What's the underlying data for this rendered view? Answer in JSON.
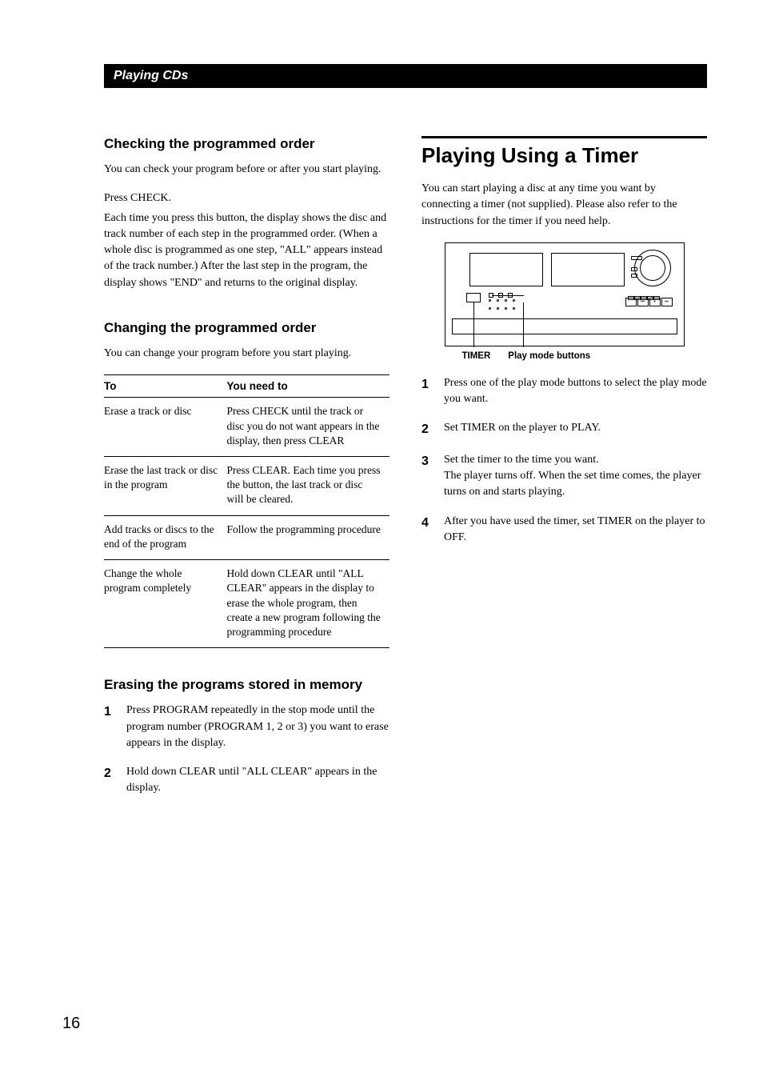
{
  "band": "Playing CDs",
  "left": {
    "h_check": "Checking the programmed order",
    "p_check": "You can check your program before or after you start playing.",
    "p_press": "Press CHECK.",
    "p_press_body": "Each time you press this button, the display shows the disc and track number of each step in the programmed order. (When a whole disc is programmed as one step, \"ALL\" appears instead of the track number.) After the last step in the program, the display shows \"END\" and returns to the original display.",
    "h_change": "Changing the programmed order",
    "p_change": "You can change your program before you start playing.",
    "th_to": "To",
    "th_need": "You need to",
    "rows": [
      {
        "to": "Erase a track or disc",
        "need": "Press CHECK until the track or disc you do not want appears in the display, then press CLEAR"
      },
      {
        "to": "Erase the last track or disc in the program",
        "need": "Press CLEAR. Each time you press the button, the last track or disc will be cleared."
      },
      {
        "to": "Add tracks or discs to the end of the program",
        "need": "Follow the programming procedure"
      },
      {
        "to": "Change the whole program completely",
        "need": "Hold down CLEAR until \"ALL CLEAR\" appears in the display to erase the whole program, then create a new program following the programming procedure"
      }
    ],
    "h_erase": "Erasing the programs stored in memory",
    "erase_steps": [
      "Press PROGRAM repeatedly in the stop mode until the program number (PROGRAM 1, 2 or 3) you want to erase appears in the display.",
      "Hold down CLEAR until \"ALL CLEAR\" appears in the display."
    ]
  },
  "right": {
    "h_main": "Playing Using a Timer",
    "p_intro": "You can start playing a disc at any time you want by connecting a timer (not supplied). Please also refer to the instructions for the timer if you need help.",
    "label_timer": "TIMER",
    "label_play": "Play mode buttons",
    "steps": [
      "Press one of the play mode buttons to select the play mode you want.",
      "Set TIMER on the player to PLAY.",
      "Set the timer to the time you want.\nThe player turns off. When the set time comes, the player turns on and starts playing.",
      "After you have used the timer, set TIMER on the player to OFF."
    ]
  },
  "page_number": "16"
}
